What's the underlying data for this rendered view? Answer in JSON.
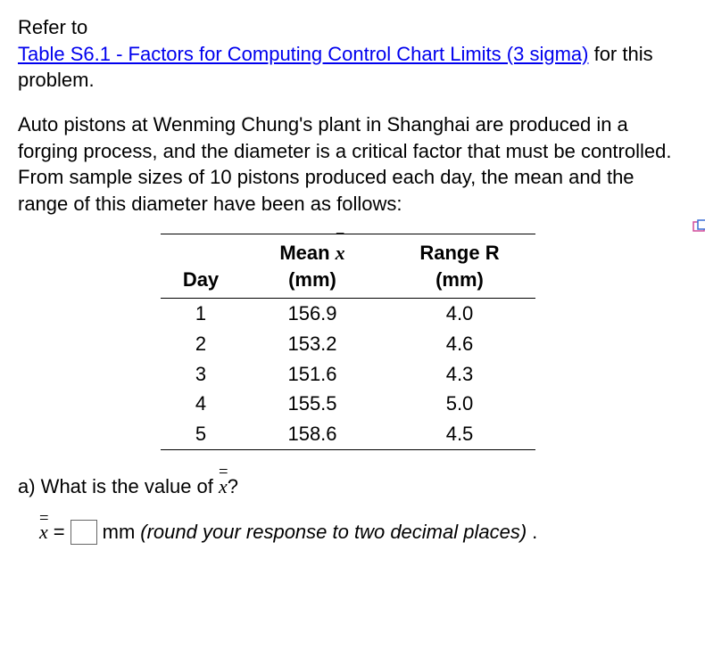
{
  "intro": {
    "pre": "Refer to",
    "link_text": "Table S6.1 - Factors for Computing Control Chart Limits (3 sigma)",
    "post": "for this problem."
  },
  "problem_text": "Auto pistons at Wenming Chung's plant in Shanghai are produced in a forging process, and the diameter is a critical factor that must be controlled. From sample sizes of 10 pistons produced each day, the mean and the range of this diameter have been as follows:",
  "table": {
    "headers": {
      "day": "Day",
      "mean_pre": "Mean ",
      "mean_var": "x",
      "mean_unit": "(mm)",
      "range": "Range R",
      "range_unit": "(mm)"
    },
    "rows": [
      {
        "day": "1",
        "mean": "156.9",
        "range": "4.0"
      },
      {
        "day": "2",
        "mean": "153.2",
        "range": "4.6"
      },
      {
        "day": "3",
        "mean": "151.6",
        "range": "4.3"
      },
      {
        "day": "4",
        "mean": "155.5",
        "range": "5.0"
      },
      {
        "day": "5",
        "mean": "158.6",
        "range": "4.5"
      }
    ]
  },
  "question": {
    "label_pre": "a) What is the value of ",
    "var": "x",
    "label_post": "?"
  },
  "answer": {
    "var": "x",
    "equals": " = ",
    "unit": " mm ",
    "hint": "(round your response to two decimal places)",
    "period": "."
  },
  "chart_data": {
    "type": "table",
    "title": "Sample mean and range of piston diameter by day",
    "columns": [
      "Day",
      "Mean x̄ (mm)",
      "Range R (mm)"
    ],
    "rows": [
      [
        1,
        156.9,
        4.0
      ],
      [
        2,
        153.2,
        4.6
      ],
      [
        3,
        151.6,
        4.3
      ],
      [
        4,
        155.5,
        5.0
      ],
      [
        5,
        158.6,
        4.5
      ]
    ]
  }
}
